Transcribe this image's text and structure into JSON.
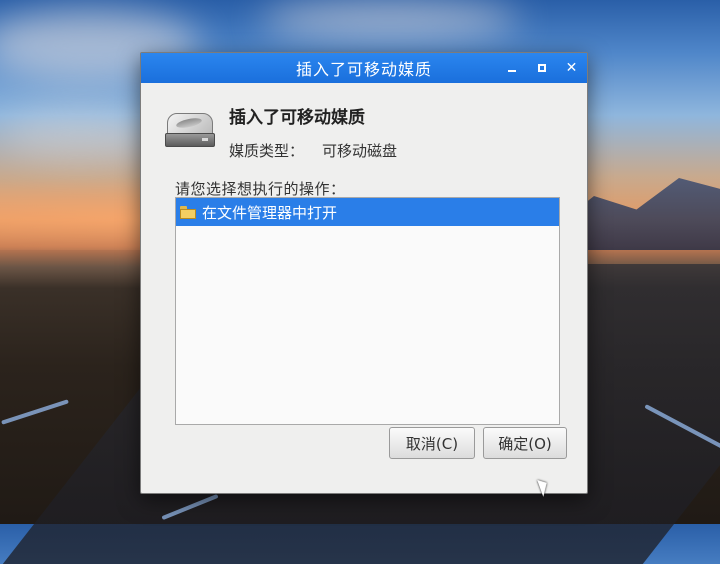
{
  "dialog": {
    "title": "插入了可移动媒质",
    "headline": "插入了可移动媒质",
    "media_type_label": "媒质类型：",
    "media_type_value": "可移动磁盘",
    "prompt": "请您选择想执行的操作：",
    "actions": [
      {
        "label": "在文件管理器中打开",
        "icon": "folder-icon",
        "selected": true
      }
    ],
    "buttons": {
      "cancel": "取消(C)",
      "ok": "确定(O)"
    },
    "icons": {
      "drive": "removable-drive-icon",
      "minimize": "minimize-icon",
      "maximize": "maximize-icon",
      "close": "close-icon"
    }
  },
  "colors": {
    "titlebar": "#1a6fdc",
    "selection": "#2a7ee8",
    "dialog_bg": "#efefee"
  }
}
